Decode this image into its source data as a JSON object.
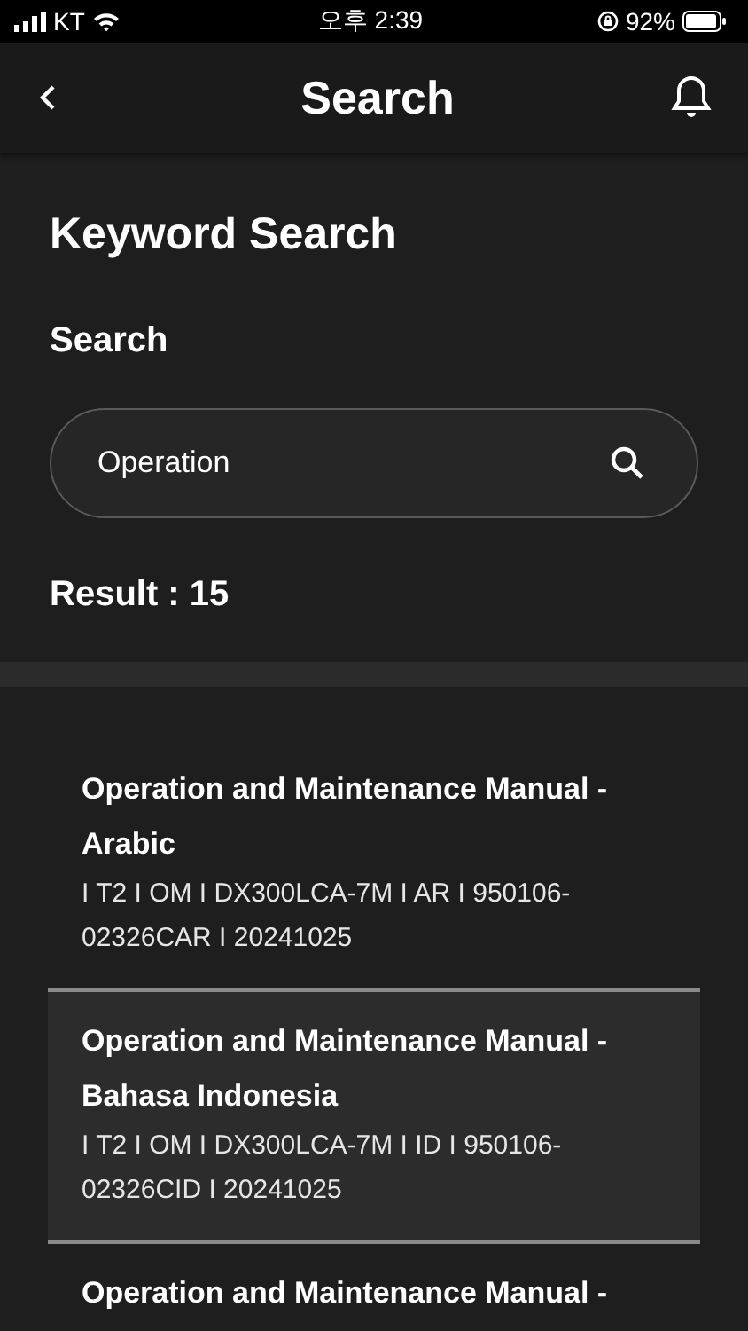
{
  "status_bar": {
    "carrier": "KT",
    "time": "오후 2:39",
    "battery": "92%"
  },
  "header": {
    "title": "Search"
  },
  "section": {
    "title": "Keyword Search",
    "label": "Search"
  },
  "search": {
    "value": "Operation"
  },
  "result": "Result : 15",
  "results": [
    {
      "title": "Operation and Maintenance Manual - Arabic",
      "meta": "I T2 I OM I DX300LCA-7M I AR I 950106-02326CAR I 20241025",
      "selected": false
    },
    {
      "title": "Operation and Maintenance Manual - Bahasa Indonesia",
      "meta": "I T2 I OM I DX300LCA-7M I ID I 950106-02326CID I 20241025",
      "selected": true
    },
    {
      "title": "Operation and Maintenance Manual -",
      "selected": false
    }
  ]
}
